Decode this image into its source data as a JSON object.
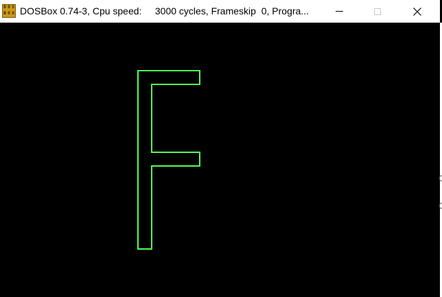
{
  "window": {
    "title": "DOSBox 0.74-3, Cpu speed:     3000 cycles, Frameskip  0, Progra...",
    "icon": {
      "name": "dosbox-icon",
      "lines": [
        "DOS",
        "BOX"
      ]
    },
    "controls": {
      "minimize": "minimize-icon",
      "maximize": "maximize-icon",
      "close": "close-icon"
    }
  },
  "screen": {
    "background": "#000000",
    "glyph": {
      "character": "F",
      "color": "#55ff55",
      "style": "outline"
    }
  },
  "colors": {
    "titlebar": "#ffffff",
    "icon_bg": "#c99a1b",
    "outline": "#55ff55"
  }
}
